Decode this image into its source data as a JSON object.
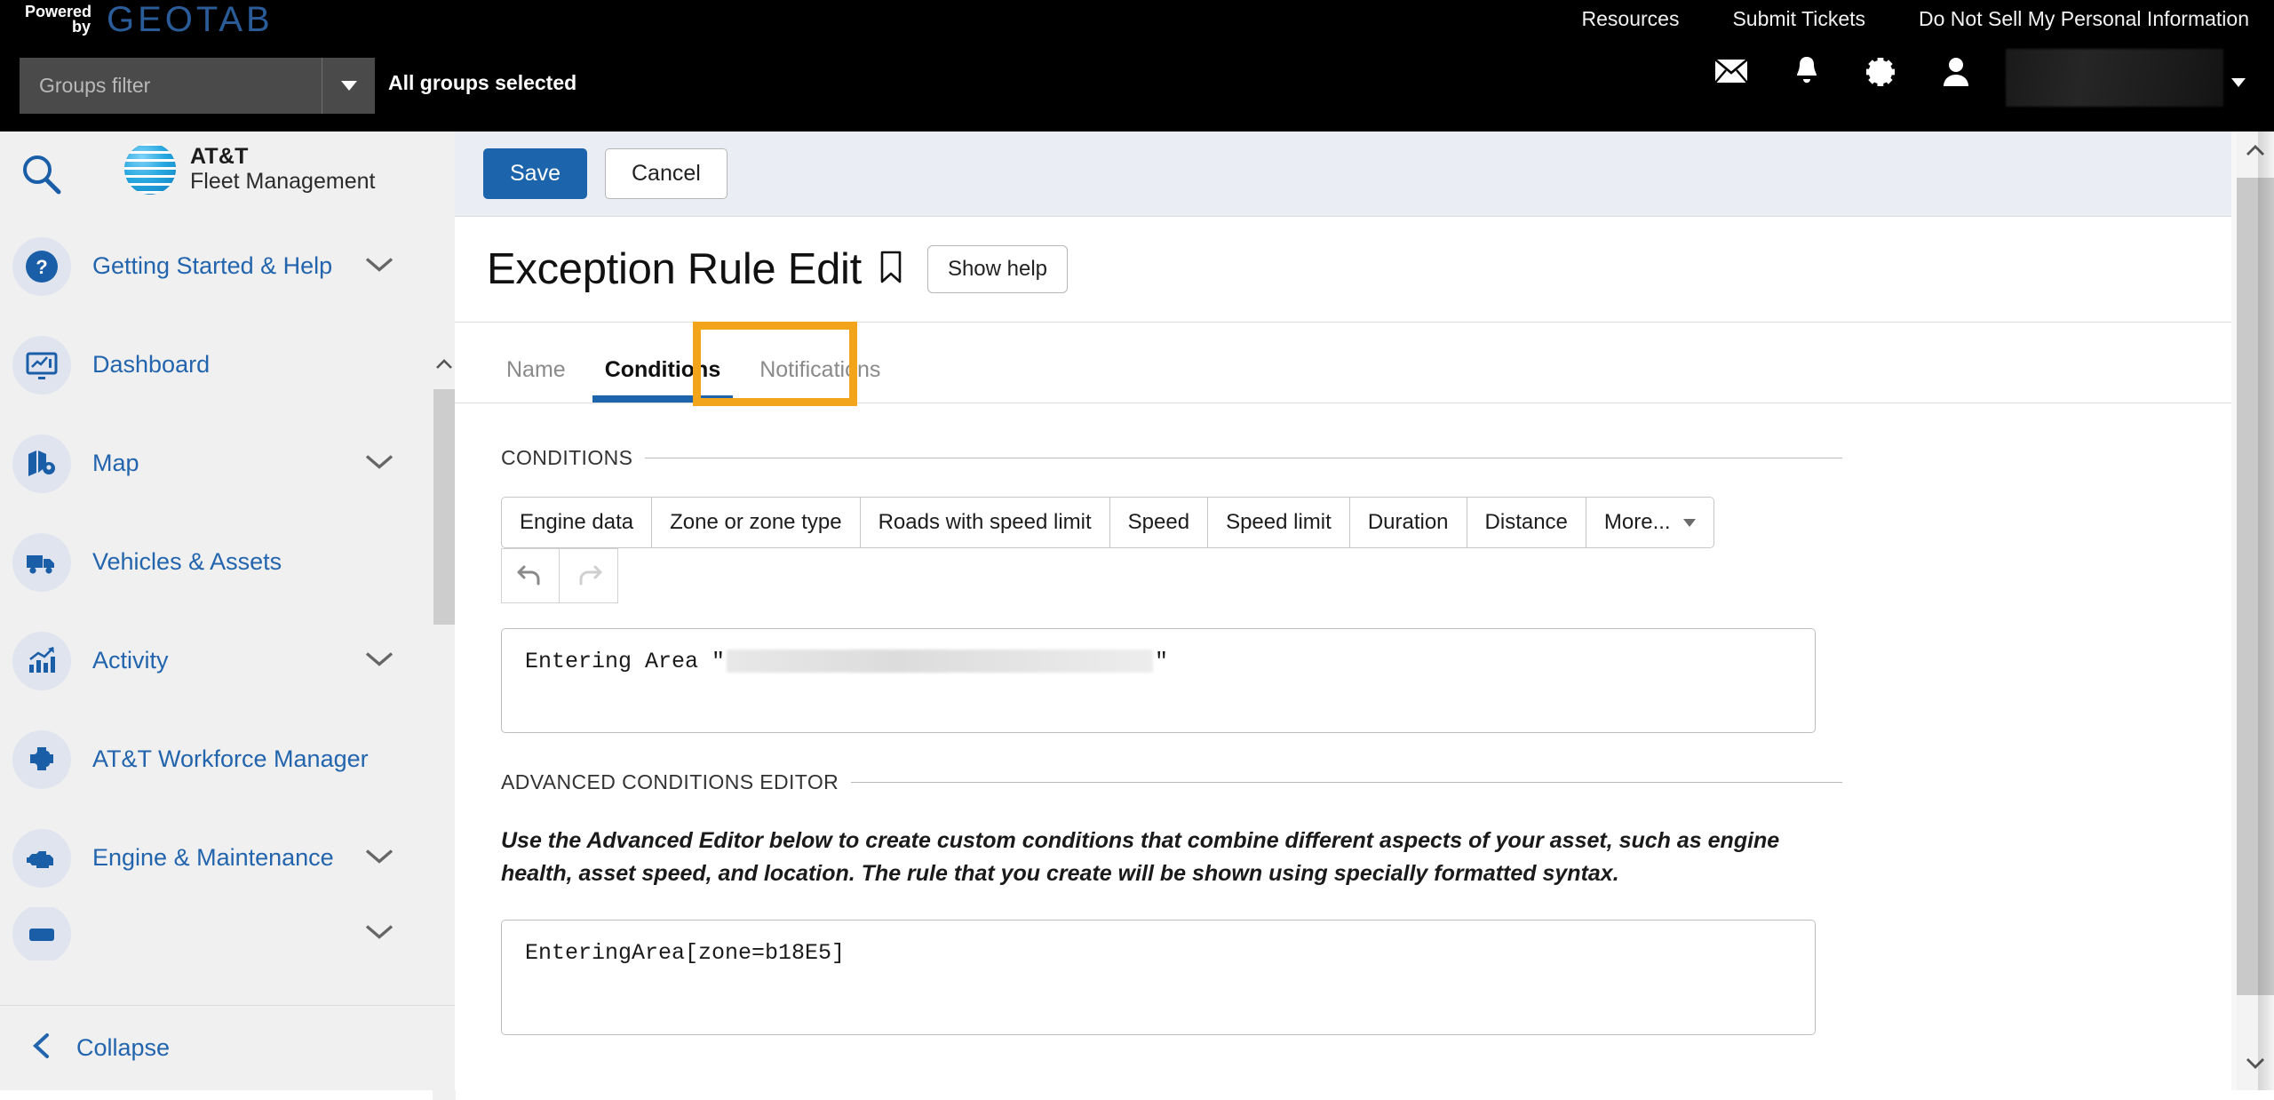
{
  "header": {
    "powered_line1": "Powered",
    "powered_line2": "by",
    "brand_word": "GEOTAB",
    "groups_filter_placeholder": "Groups filter",
    "groups_filter_value": "",
    "groups_status": "All groups selected",
    "links": [
      {
        "label": "Resources",
        "name": "resources-link"
      },
      {
        "label": "Submit Tickets",
        "name": "submit-tickets-link"
      },
      {
        "label": "Do Not Sell My Personal Information",
        "name": "do-not-sell-link"
      }
    ],
    "icons": [
      "mail-icon",
      "bell-icon",
      "gear-icon",
      "user-icon"
    ],
    "user_name_redacted": ""
  },
  "sidebar": {
    "search_placeholder": "",
    "brand_line1": "AT&T",
    "brand_line2": "Fleet Management",
    "items": [
      {
        "label": "Getting Started & Help",
        "icon": "help-circle-icon",
        "expandable": true
      },
      {
        "label": "Dashboard",
        "icon": "dashboard-icon",
        "expandable": false
      },
      {
        "label": "Map",
        "icon": "map-icon",
        "expandable": true
      },
      {
        "label": "Vehicles & Assets",
        "icon": "truck-icon",
        "expandable": false
      },
      {
        "label": "Activity",
        "icon": "activity-chart-icon",
        "expandable": true
      },
      {
        "label": "AT&T Workforce Manager",
        "icon": "puzzle-icon",
        "expandable": false
      },
      {
        "label": "Engine & Maintenance",
        "icon": "engine-icon",
        "expandable": true
      }
    ],
    "collapse_label": "Collapse"
  },
  "main": {
    "save_label": "Save",
    "cancel_label": "Cancel",
    "page_title": "Exception Rule Edit",
    "show_help_label": "Show help",
    "tabs": [
      {
        "label": "Name",
        "active": false
      },
      {
        "label": "Conditions",
        "active": true
      },
      {
        "label": "Notifications",
        "active": false,
        "highlighted": true
      }
    ],
    "conditions": {
      "section_title": "CONDITIONS",
      "buttons": [
        "Engine data",
        "Zone or zone type",
        "Roads with speed limit",
        "Speed",
        "Speed limit",
        "Duration",
        "Distance",
        "More..."
      ],
      "undo_label": "undo-icon",
      "redo_label": "redo-icon",
      "expression_prefix": "Entering Area \"",
      "expression_suffix": "\"",
      "expression_redacted_value": ""
    },
    "advanced": {
      "section_title": "ADVANCED CONDITIONS EDITOR",
      "description": "Use the Advanced Editor below to create custom conditions that combine different aspects of your asset, such as engine health, asset speed, and location. The rule that you create will be shown using specially formatted syntax.",
      "code_value": "EnteringArea[zone=b18E5]"
    }
  },
  "colors": {
    "accent_blue": "#1c64ac",
    "highlight_orange": "#f2a51a",
    "link_blue": "#2264ad",
    "header_black": "#000000"
  }
}
